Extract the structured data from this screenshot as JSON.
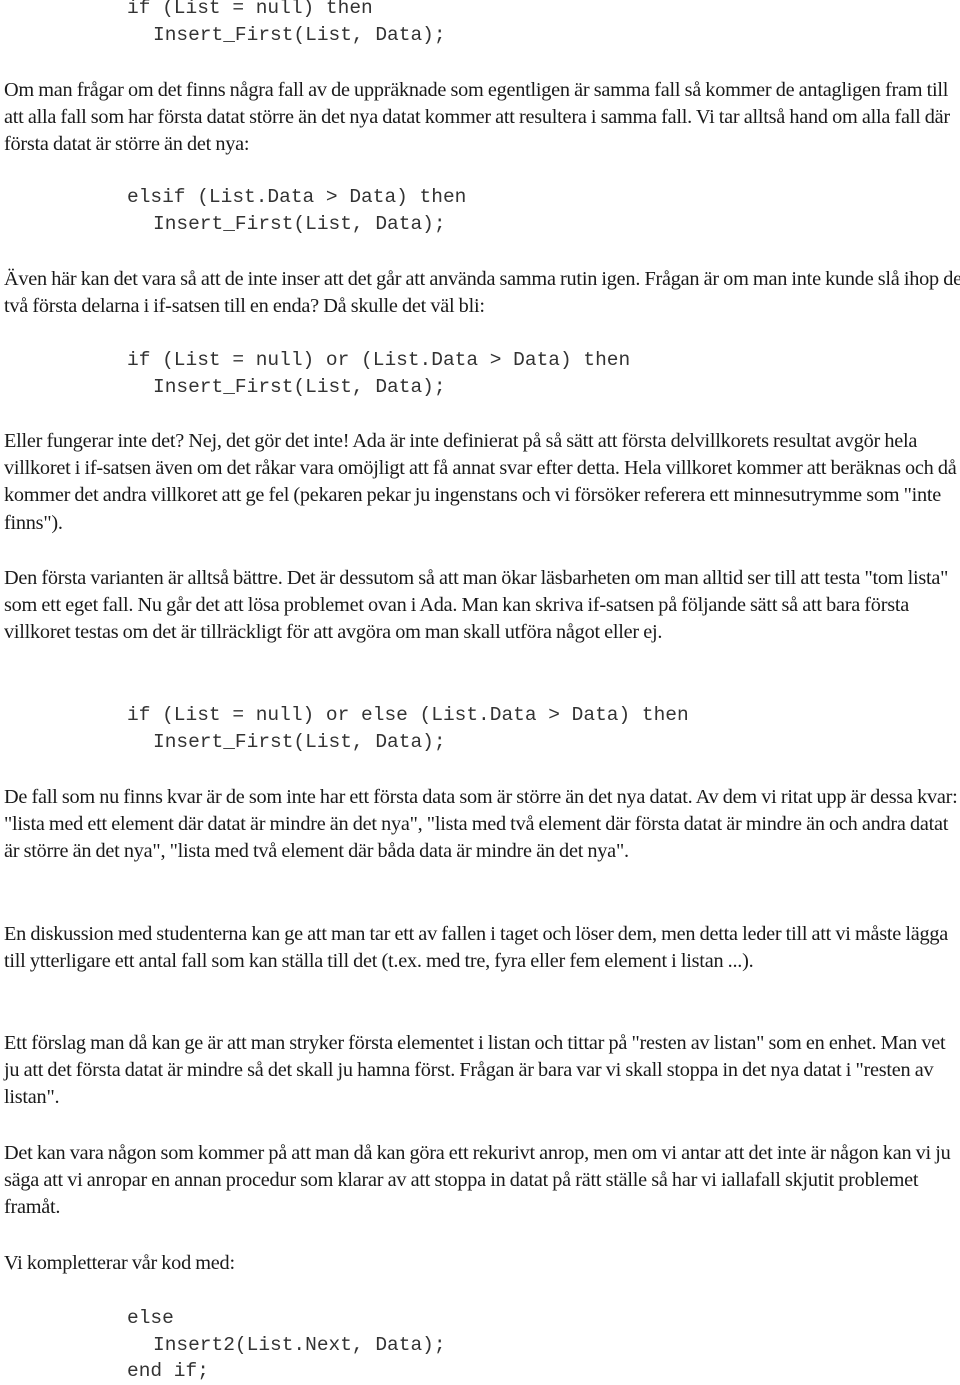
{
  "document": {
    "code_blocks": [
      {
        "lines": [
          "if (List = null) then",
          "Insert_First(List, Data);"
        ]
      },
      {
        "lines": [
          "elsif (List.Data > Data) then",
          "Insert_First(List, Data);"
        ]
      },
      {
        "lines": [
          "if (List = null) or (List.Data > Data) then",
          "Insert_First(List, Data);"
        ]
      },
      {
        "lines": [
          "if (List = null) or else (List.Data > Data) then",
          "Insert_First(List, Data);"
        ]
      },
      {
        "lines": [
          "else",
          "Insert2(List.Next, Data);",
          "end if;"
        ]
      }
    ],
    "paragraphs": [
      "Om man frågar om det finns några fall av de uppräknade som egentligen är samma fall så kommer de antagligen fram till att alla fall som har första datat större än det nya datat kommer att resultera i samma fall. Vi tar alltså hand om alla fall där första datat är större än det nya:",
      "Även här kan det vara så att de inte inser att det går att använda samma rutin igen. Frågan är om man inte kunde slå ihop de två första delarna i if-satsen till en enda? Då skulle det väl bli:",
      "Eller fungerar inte det? Nej, det gör det inte! Ada är inte definierat på så sätt att första delvillkorets resultat avgör hela villkoret i if-satsen även om det råkar vara omöjligt att få annat svar efter detta. Hela villkoret kommer att beräknas och då kommer det andra villkoret att ge fel (pekaren pekar ju ingenstans och vi försöker referera ett minnesutrymme som \"inte finns\").",
      "Den första varianten är alltså bättre. Det är dessutom så att man ökar läsbarheten om man alltid ser till att testa \"tom lista\" som ett eget fall. Nu går det att lösa problemet ovan i Ada. Man kan skriva if-satsen på följande sätt så att bara första villkoret testas om det är tillräckligt för att avgöra om man skall utföra något eller ej.",
      "De fall som nu finns kvar är de som inte har ett första data som är större än det nya datat. Av dem vi ritat upp är dessa kvar: \"lista med ett element där datat är mindre än det nya\", \"lista med två element där första datat är mindre än och andra datat är större än det nya\", \"lista med två element där båda data är mindre än det nya\".",
      "En diskussion med studenterna kan ge att man tar ett av fallen i taget och löser dem, men detta leder till att vi måste lägga till ytterligare ett antal fall som kan ställa till det (t.ex. med tre, fyra eller fem element i listan ...).",
      "Ett förslag man då kan ge är att man stryker första elementet i listan och tittar på \"resten av listan\" som en enhet. Man vet ju att det första datat är mindre så det skall ju hamna först. Frågan är bara var vi skall stoppa in det nya datat i \"resten av listan\".",
      "Det kan vara någon som kommer på att man då kan göra ett rekurivt anrop, men om vi antar att det inte är någon kan vi ju säga att vi anropar en annan procedur som klarar av att stoppa in datat på rätt ställe så har vi iallafall skjutit problemet framåt.",
      "Vi kompletterar vår kod med:"
    ]
  }
}
